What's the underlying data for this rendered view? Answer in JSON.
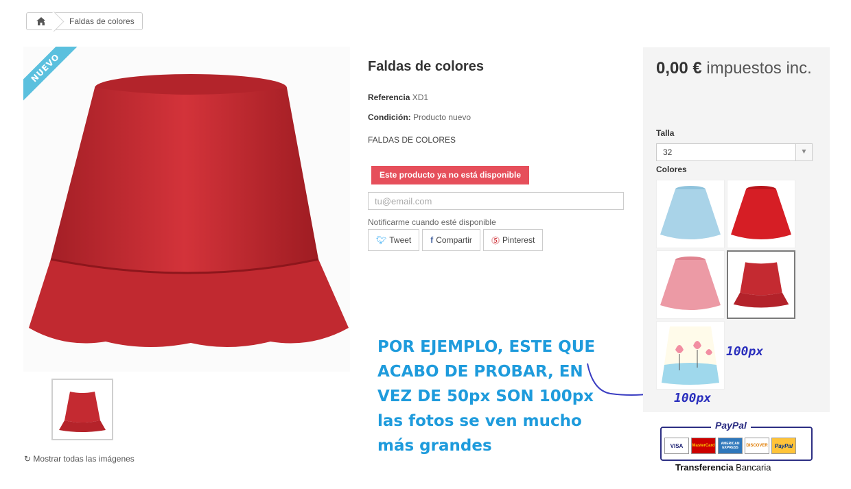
{
  "breadcrumb": {
    "home_icon": "home-icon",
    "current": "Faldas de colores"
  },
  "product": {
    "badge": "NUEVO",
    "title": "Faldas de colores",
    "reference_label": "Referencia",
    "reference_value": "XD1",
    "condition_label": "Condición:",
    "condition_value": "Producto nuevo",
    "description": "FALDAS DE COLORES",
    "unavailable": "Este producto ya no está disponible",
    "email_placeholder": "tu@email.com",
    "notify_label": "Notificarme cuando esté disponible",
    "show_all_images": "Mostrar todas las imágenes"
  },
  "share": {
    "tweet": "Tweet",
    "facebook": "Compartir",
    "pinterest": "Pinterest"
  },
  "price_box": {
    "price": "0,00 €",
    "tax": "impuestos inc.",
    "size_label": "Talla",
    "size_selected": "32",
    "colors_label": "Colores"
  },
  "annotation": {
    "text": "POR EJEMPLO, ESTE QUE ACABO DE PROBAR, EN VEZ DE 50px SON 100px las fotos se ven mucho más grandes",
    "width_note": "100px",
    "height_note": "100px"
  },
  "payment": {
    "brand": "PayPal",
    "cards": [
      "VISA",
      "MasterCard",
      "AMERICAN EXPRESS",
      "DISCOVER",
      "PayPal"
    ],
    "caption_bold": "Transferencia",
    "caption_rest": "Bancaria"
  },
  "colors": {
    "accent_blue": "#5bc0de",
    "alert_red": "#e64f5b",
    "annotation_blue": "#1e9bdc",
    "skirt_red": "#c0282f"
  }
}
